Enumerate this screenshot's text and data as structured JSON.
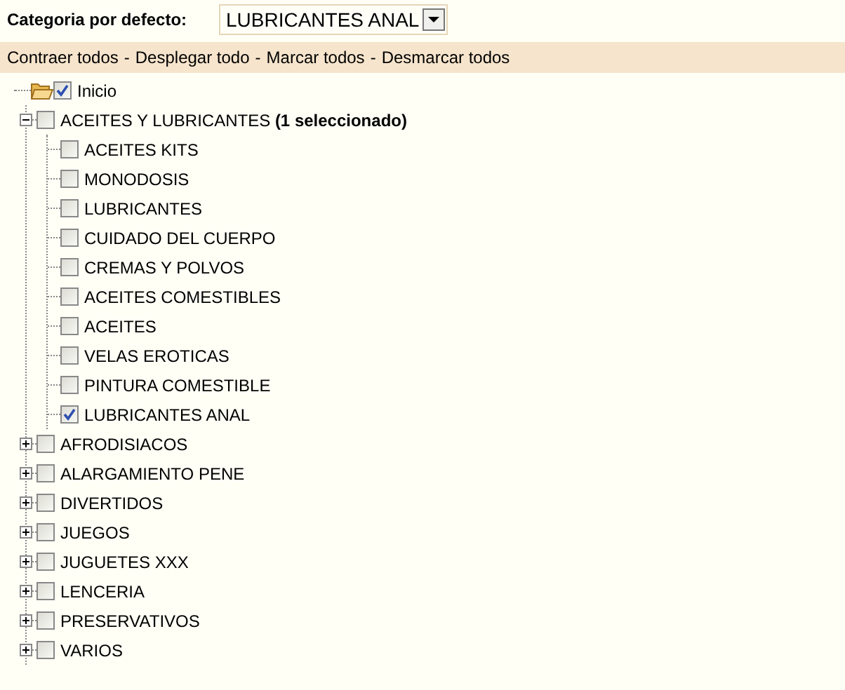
{
  "default_category": {
    "label": "Categoria por defecto:",
    "value": "LUBRICANTES ANAL"
  },
  "actions": {
    "separator": "-",
    "links": [
      "Contraer todos",
      "Desplegar todo",
      "Marcar todos",
      "Desmarcar todos"
    ]
  },
  "tree": {
    "label": "Inicio",
    "checked": true,
    "children": [
      {
        "label": "ACEITES Y LUBRICANTES **(1 seleccionado)**",
        "expanded": true,
        "checked": false,
        "children": [
          {
            "label": "ACEITES KITS",
            "checked": false
          },
          {
            "label": "MONODOSIS",
            "checked": false
          },
          {
            "label": "LUBRICANTES",
            "checked": false
          },
          {
            "label": "CUIDADO DEL CUERPO",
            "checked": false
          },
          {
            "label": "CREMAS Y POLVOS",
            "checked": false
          },
          {
            "label": "ACEITES COMESTIBLES",
            "checked": false
          },
          {
            "label": "ACEITES",
            "checked": false
          },
          {
            "label": "VELAS EROTICAS",
            "checked": false
          },
          {
            "label": "PINTURA COMESTIBLE",
            "checked": false
          },
          {
            "label": "LUBRICANTES ANAL",
            "checked": true
          }
        ]
      },
      {
        "label": "AFRODISIACOS",
        "expanded": false,
        "checked": false
      },
      {
        "label": "ALARGAMIENTO PENE",
        "expanded": false,
        "checked": false
      },
      {
        "label": "DIVERTIDOS",
        "expanded": false,
        "checked": false
      },
      {
        "label": "JUEGOS",
        "expanded": false,
        "checked": false
      },
      {
        "label": "JUGUETES XXX",
        "expanded": false,
        "checked": false
      },
      {
        "label": "LENCERIA",
        "expanded": false,
        "checked": false
      },
      {
        "label": "PRESERVATIVOS",
        "expanded": false,
        "checked": false
      },
      {
        "label": "VARIOS",
        "expanded": false,
        "checked": false
      }
    ]
  }
}
